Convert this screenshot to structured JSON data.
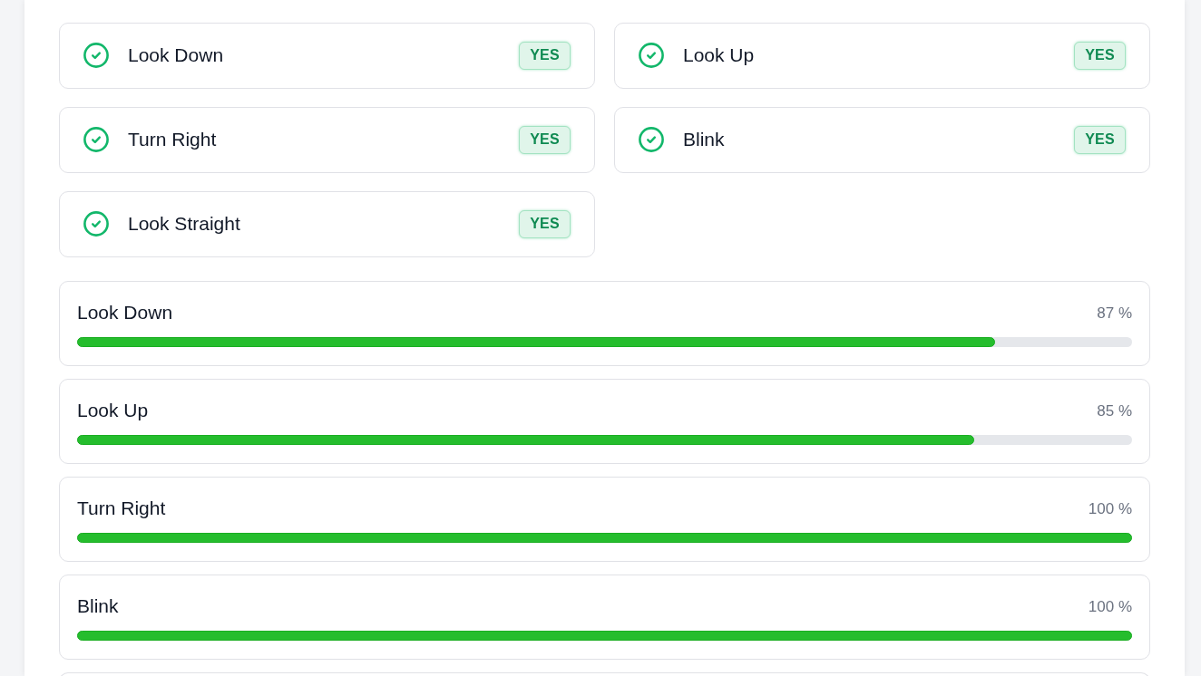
{
  "checks": [
    {
      "label": "Look Down",
      "badge": "YES",
      "passed": true
    },
    {
      "label": "Look Up",
      "badge": "YES",
      "passed": true
    },
    {
      "label": "Turn Right",
      "badge": "YES",
      "passed": true
    },
    {
      "label": "Blink",
      "badge": "YES",
      "passed": true
    },
    {
      "label": "Look Straight",
      "badge": "YES",
      "passed": true
    }
  ],
  "scores": [
    {
      "label": "Look Down",
      "reading": "87 %",
      "level": 0.87
    },
    {
      "label": "Look Up",
      "reading": "85 %",
      "level": 0.85
    },
    {
      "label": "Turn Right",
      "reading": "100 %",
      "level": 1.0
    },
    {
      "label": "Blink",
      "reading": "100 %",
      "level": 1.0
    }
  ]
}
